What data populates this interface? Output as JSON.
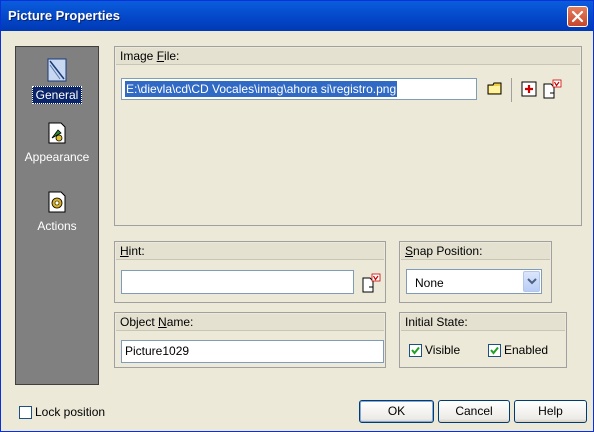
{
  "window": {
    "title": "Picture Properties"
  },
  "sidebar": {
    "items": [
      {
        "label": "General",
        "icon": "general-icon",
        "selected": true
      },
      {
        "label": "Appearance",
        "icon": "appearance-icon",
        "selected": false
      },
      {
        "label": "Actions",
        "icon": "actions-icon",
        "selected": false
      }
    ]
  },
  "image_file": {
    "label_pre": "Image ",
    "label_accel": "F",
    "label_post": "ile:",
    "value": "E:\\dievla\\cd\\CD Vocales\\imag\\ahora si\\registro.png"
  },
  "hint": {
    "label_accel": "H",
    "label_post": "int:",
    "value": ""
  },
  "snap_position": {
    "label_accel": "S",
    "label_post": "nap Position:",
    "selected": "None"
  },
  "object_name": {
    "label_pre": "Object ",
    "label_accel": "N",
    "label_post": "ame:",
    "value": "Picture1029"
  },
  "initial_state": {
    "label": "Initial State:",
    "visible": {
      "label": "Visible",
      "checked": true
    },
    "enabled": {
      "label": "Enabled",
      "checked": true
    }
  },
  "lock_position": {
    "label": "Lock position",
    "checked": false
  },
  "buttons": {
    "ok": "OK",
    "cancel": "Cancel",
    "help": "Help"
  },
  "colors": {
    "titlebar": "#0a5ddd",
    "dialog_bg": "#ece9d8",
    "sidebar_bg": "#808080",
    "selection": "#316ac5"
  }
}
